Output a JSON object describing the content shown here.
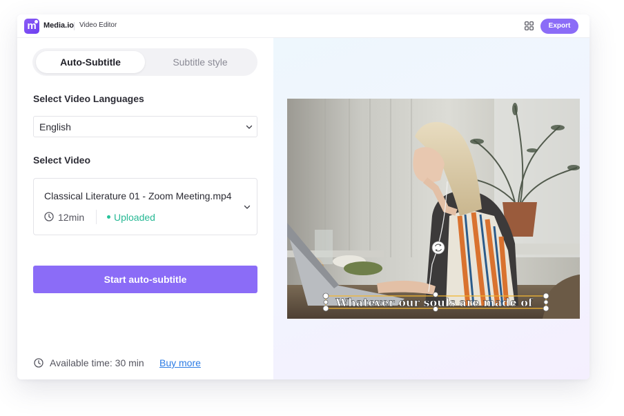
{
  "header": {
    "logo_letter": "m",
    "brand": "Media.io",
    "product": "Video Editor",
    "apps_icon": "grid-apps-icon",
    "export_label": "Export",
    "accent_color": "#8b6cf7"
  },
  "tabs": [
    {
      "label": "Auto-Subtitle",
      "active": true
    },
    {
      "label": "Subtitle style",
      "active": false
    }
  ],
  "language": {
    "label": "Select Video Languages",
    "value": "English"
  },
  "video": {
    "label": "Select Video",
    "file_name": "Classical Literature 01 - Zoom Meeting.mp4",
    "duration": "12min",
    "status": "Uploaded",
    "status_color": "#26b894"
  },
  "actions": {
    "start_label": "Start auto-subtitle"
  },
  "footer": {
    "available": "Available time: 30 min",
    "buy_more": "Buy more"
  },
  "preview": {
    "subtitle": "Whatever our souls are made of"
  }
}
